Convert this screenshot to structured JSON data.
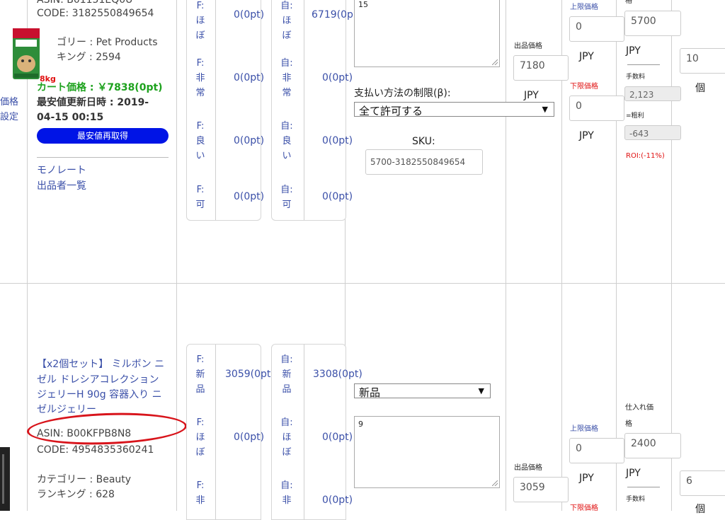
{
  "left_edge": {
    "line1": "価格",
    "line2": "設定"
  },
  "product1": {
    "asin": "ASIN: B01151EQ0U",
    "code": "CODE: 3182550849654",
    "category": "ゴリー : Pet Products",
    "ranking": "キング : 2594",
    "weight_badge": "8kg",
    "cart_price": "カート価格 : ￥7838(0pt)",
    "updated_label": "最安値更新日時 : 2019-",
    "updated_time": "04-15 00:15",
    "refetch_button": "最安値再取得",
    "monorate_link": "モノレート",
    "sellers_link": "出品者一覧"
  },
  "product1_conditions_fba": [
    {
      "label": "F:ほぼ",
      "value": "0(0pt)"
    },
    {
      "label": "F:非常",
      "value": "0(0pt)"
    },
    {
      "label": "F:良い",
      "value": "0(0pt)"
    },
    {
      "label": "F:可",
      "value": "0(0pt)"
    }
  ],
  "product1_conditions_self": [
    {
      "label": "自:ほぼ",
      "value": "6719(0p"
    },
    {
      "label": "自:非常",
      "value": "0(0pt)"
    },
    {
      "label": "自:良い",
      "value": "0(0pt)"
    },
    {
      "label": "自:可",
      "value": "0(0pt)"
    }
  ],
  "product1_form": {
    "note_value": "15",
    "payment_label": "支払い方法の制限(β):",
    "payment_select": "全て許可する",
    "sku_label": "SKU:",
    "sku_value": "5700-3182550849654",
    "listing_price_label": "出品価格",
    "listing_price": "7180",
    "listing_currency": "JPY",
    "upper_label": "上限価格",
    "upper_value": "0",
    "upper_currency": "JPY",
    "lower_label": "下限価格",
    "lower_value": "0",
    "lower_currency": "JPY",
    "cost_label_partial": "格",
    "cost_value": "5700",
    "cost_currency": "JPY",
    "fee_label": "手数料",
    "fee_value": "2,123",
    "profit_label": "=粗利",
    "profit_value": "-643",
    "roi": "ROI:(-11%)",
    "qty_value": "10",
    "qty_unit": "個"
  },
  "product2": {
    "title_line1": "【x2個セット】 ミルボン ニ",
    "title_line2": "ゼル ドレシアコレクション",
    "title_line3": "ジェリーH 90g 容器入り ニ",
    "title_line4": "ゼルジェリー",
    "asin": "ASIN: B00KFPB8N8",
    "code": "CODE: 4954835360241",
    "category": "カテゴリー : Beauty",
    "ranking": "ランキング : 628"
  },
  "product2_conditions_fba": [
    {
      "label": "F:新品",
      "value": "3059(0pt)"
    },
    {
      "label": "F:ほぼ",
      "value": "0(0pt)"
    },
    {
      "label": "F:非",
      "value": ""
    }
  ],
  "product2_conditions_self": [
    {
      "label": "自:新品",
      "value": "3308(0pt)"
    },
    {
      "label": "自:ほぼ",
      "value": "0(0pt)"
    },
    {
      "label": "自:非",
      "value": "0(0pt)"
    }
  ],
  "product2_form": {
    "condition_select": "新品",
    "note_value": "9",
    "listing_price_label": "出品価格",
    "listing_price": "3059",
    "upper_label": "上限価格",
    "upper_value": "0",
    "upper_currency": "JPY",
    "lower_label_partial": "下限価格",
    "cost_label_line1": "仕入れ価",
    "cost_label_line2": "格",
    "cost_value": "2400",
    "cost_currency": "JPY",
    "fee_label": "手数料",
    "qty_value": "6",
    "qty_unit": "個"
  },
  "colors": {
    "link_blue": "#3a4fa8",
    "cart_green": "#1ea21e",
    "button_blue": "#0014e6",
    "red": "#e01010",
    "annotation_red": "#d8141b"
  }
}
